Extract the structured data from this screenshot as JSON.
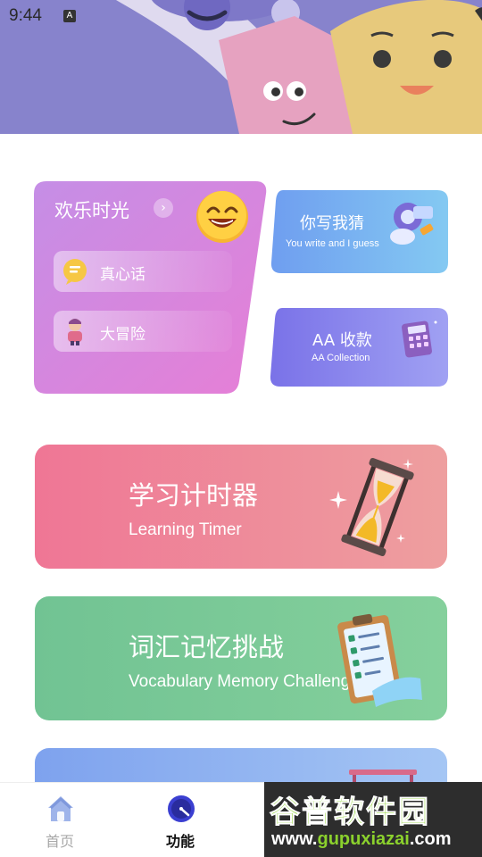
{
  "status_bar": {
    "time": "9:44",
    "notification_glyph": "A",
    "icons": [
      "wifi-icon",
      "signal-icon",
      "battery-charging-icon"
    ]
  },
  "fun_card": {
    "title": "欢乐时光",
    "items": [
      {
        "label": "真心话",
        "icon": "chat-bubble-icon"
      },
      {
        "label": "大冒险",
        "icon": "adventurer-icon"
      }
    ]
  },
  "small_cards": [
    {
      "title": "你写我猜",
      "subtitle": "You write and I guess",
      "icon": "drawing-guess-icon"
    },
    {
      "title": "AA 收款",
      "subtitle": "AA Collection",
      "icon": "calculator-icon"
    }
  ],
  "wide_cards": [
    {
      "title": "学习计时器",
      "subtitle": "Learning Timer",
      "icon": "hourglass-icon",
      "color": "#ee7b95"
    },
    {
      "title": "词汇记忆挑战",
      "subtitle": "Vocabulary Memory Challenge",
      "icon": "checklist-clipboard-icon",
      "color": "#74c997"
    },
    {
      "title": "",
      "subtitle": "",
      "icon": "abacus-icon",
      "color": "#8fb2f0"
    }
  ],
  "bottom_nav": [
    {
      "label": "首页",
      "icon": "home-icon",
      "active": false
    },
    {
      "label": "功能",
      "icon": "compass-dial-icon",
      "active": true
    }
  ],
  "watermark": {
    "title": "谷普软件园",
    "url_prefix": "www.",
    "url_brand": "gupuxiazai",
    "url_suffix": ".com"
  }
}
